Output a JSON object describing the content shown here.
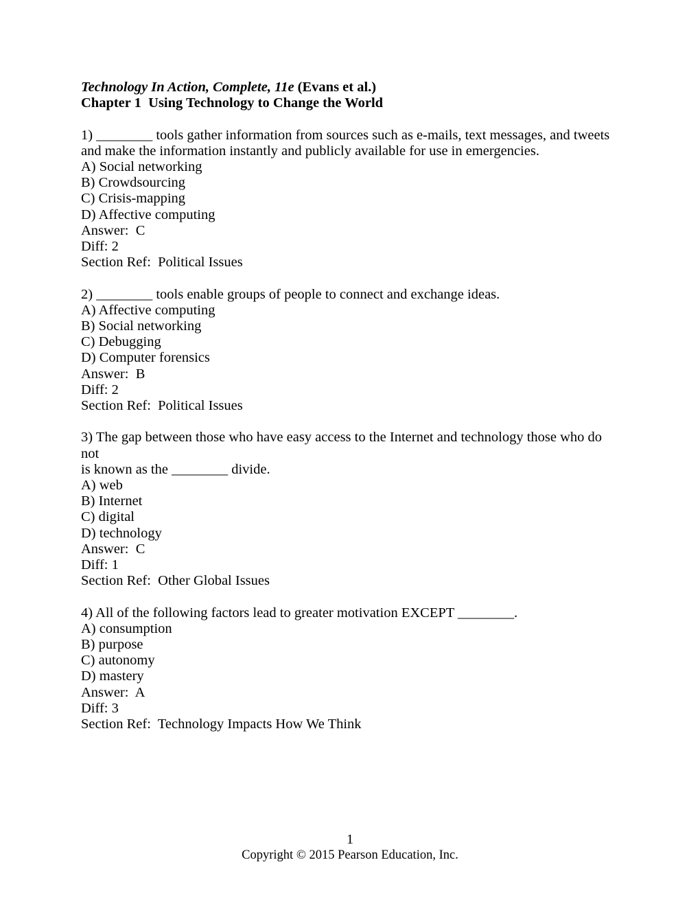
{
  "header": {
    "book_title": "Technology In Action, Complete, 11e",
    "book_authors": " (Evans et al.)",
    "chapter_line": "Chapter 1  Using Technology to Change the World"
  },
  "questions": [
    {
      "stem_line_1": "1) ________ tools gather information from sources such as e-mails, text messages, and tweets",
      "stem_line_2": "and make the information instantly and publicly available for use in emergencies.",
      "option_a": "A) Social networking",
      "option_b": "B) Crowdsourcing",
      "option_c": "C) Crisis-mapping",
      "option_d": "D) Affective computing",
      "answer": "Answer:  C",
      "diff": "Diff: 2",
      "section_ref": "Section Ref:  Political Issues"
    },
    {
      "stem_line_1": "2) ________ tools enable groups of people to connect and exchange ideas.",
      "stem_line_2": "",
      "option_a": "A) Affective computing",
      "option_b": "B) Social networking",
      "option_c": "C) Debugging",
      "option_d": "D) Computer forensics",
      "answer": "Answer:  B",
      "diff": "Diff: 2",
      "section_ref": "Section Ref:  Political Issues"
    },
    {
      "stem_line_1": "3) The gap between those who have easy access to the Internet and technology those who do not",
      "stem_line_2": "is known as the ________ divide.",
      "option_a": "A) web",
      "option_b": "B) Internet",
      "option_c": "C) digital",
      "option_d": "D) technology",
      "answer": "Answer:  C",
      "diff": "Diff: 1",
      "section_ref": "Section Ref:  Other Global Issues"
    },
    {
      "stem_line_1": "4) All of the following factors lead to greater motivation EXCEPT ________.",
      "stem_line_2": "",
      "option_a": "A) consumption",
      "option_b": "B) purpose",
      "option_c": "C) autonomy",
      "option_d": "D) mastery",
      "answer": "Answer:  A",
      "diff": "Diff: 3",
      "section_ref": "Section Ref:  Technology Impacts How We Think"
    }
  ],
  "footer": {
    "page_number": "1",
    "copyright": "Copyright © 2015 Pearson Education, Inc."
  }
}
